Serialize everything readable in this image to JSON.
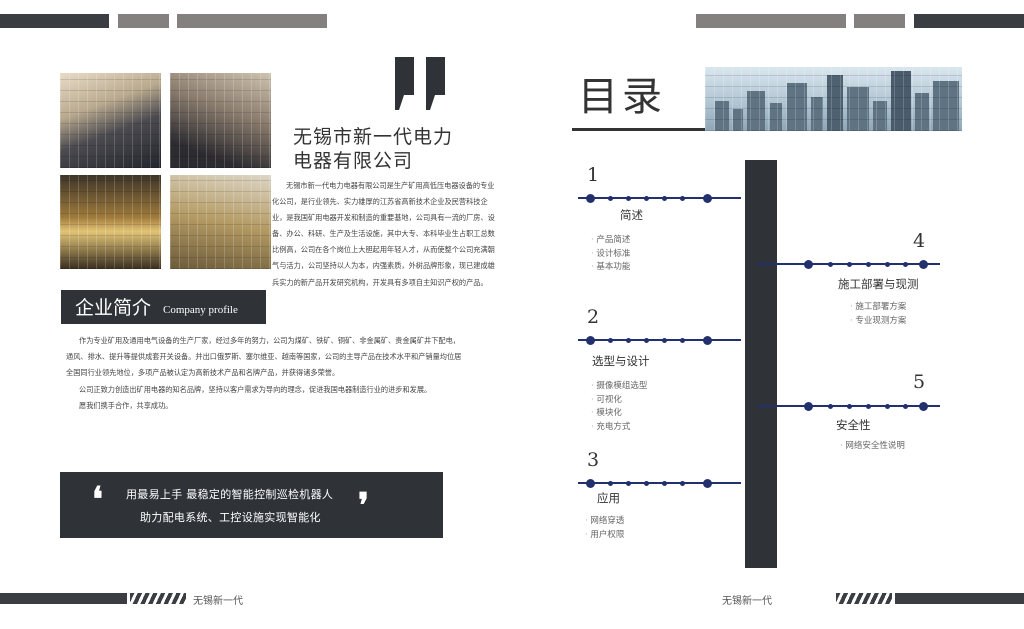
{
  "company": {
    "name_line1": "无锡市新一代电力",
    "name_line2": "电器有限公司",
    "intro": "无锡市新一代电力电器有限公司是生产矿用高低压电器设备的专业化公司，是行业领先、实力雄厚的江苏省高新技术企业及民营科技企业，是我国矿用电器开发和制造的重要基地，公司具有一流的厂房、设备、办公、科研、生产及生活设施，其中大专、本科毕业生占职工总数比例高，公司在各个岗位上大胆起用年轻人才，从而使整个公司充满朝气与活力，公司坚持以人为本，内强素质，外树品牌形象，现已建成雄兵实力的新产品开发研究机构，开发具有多项自主知识产权的产品。"
  },
  "profile": {
    "title_cn": "企业简介",
    "title_en": "Company profile",
    "paragraphs": [
      "作为专业矿用及通用电气设备的生产厂家，经过多年的努力，公司为煤矿、铁矿、铜矿、非金属矿、贵金属矿井下配电，通风、排水、提升等提供成套开关设备。并出口俄罗斯、塞尔维亚、越南等国家，公司的主导产品在技术水平和产销量均位居全国同行业领先地位，多项产品被认定为高新技术产品和名牌产品，并获得诸多荣誉。",
      "公司正致力创造出矿用电器的知名品牌，坚持以客户需求为导向的理念，促进我国电器制造行业的进步和发展。",
      "愿我们携手合作，共享成功。"
    ]
  },
  "slogan": {
    "line1": "用最易上手 最稳定的智能控制巡检机器人",
    "line2": "助力配电系统、工控设施实现智能化",
    "open_quote": "❛",
    "close_quote": "❜"
  },
  "footer": {
    "left_text": "无锡新一代",
    "right_text": "无锡新一代"
  },
  "toc": {
    "title": "目录",
    "sections": [
      {
        "num": "1",
        "title": "简述",
        "items": [
          "产品简述",
          "设计标准",
          "基本功能"
        ]
      },
      {
        "num": "2",
        "title": "选型与设计",
        "items": [
          "摄像模组选型",
          "可视化",
          "模块化",
          "充电方式"
        ]
      },
      {
        "num": "3",
        "title": "应用",
        "items": [
          "网络穿透",
          "用户权限"
        ]
      },
      {
        "num": "4",
        "title": "施工部署与现测",
        "items": [
          "施工部署方案",
          "专业现测方案"
        ]
      },
      {
        "num": "5",
        "title": "安全性",
        "items": [
          "网络安全性说明"
        ]
      }
    ]
  },
  "colors": {
    "dark": "#2f3338",
    "line_blue": "#23306e"
  }
}
